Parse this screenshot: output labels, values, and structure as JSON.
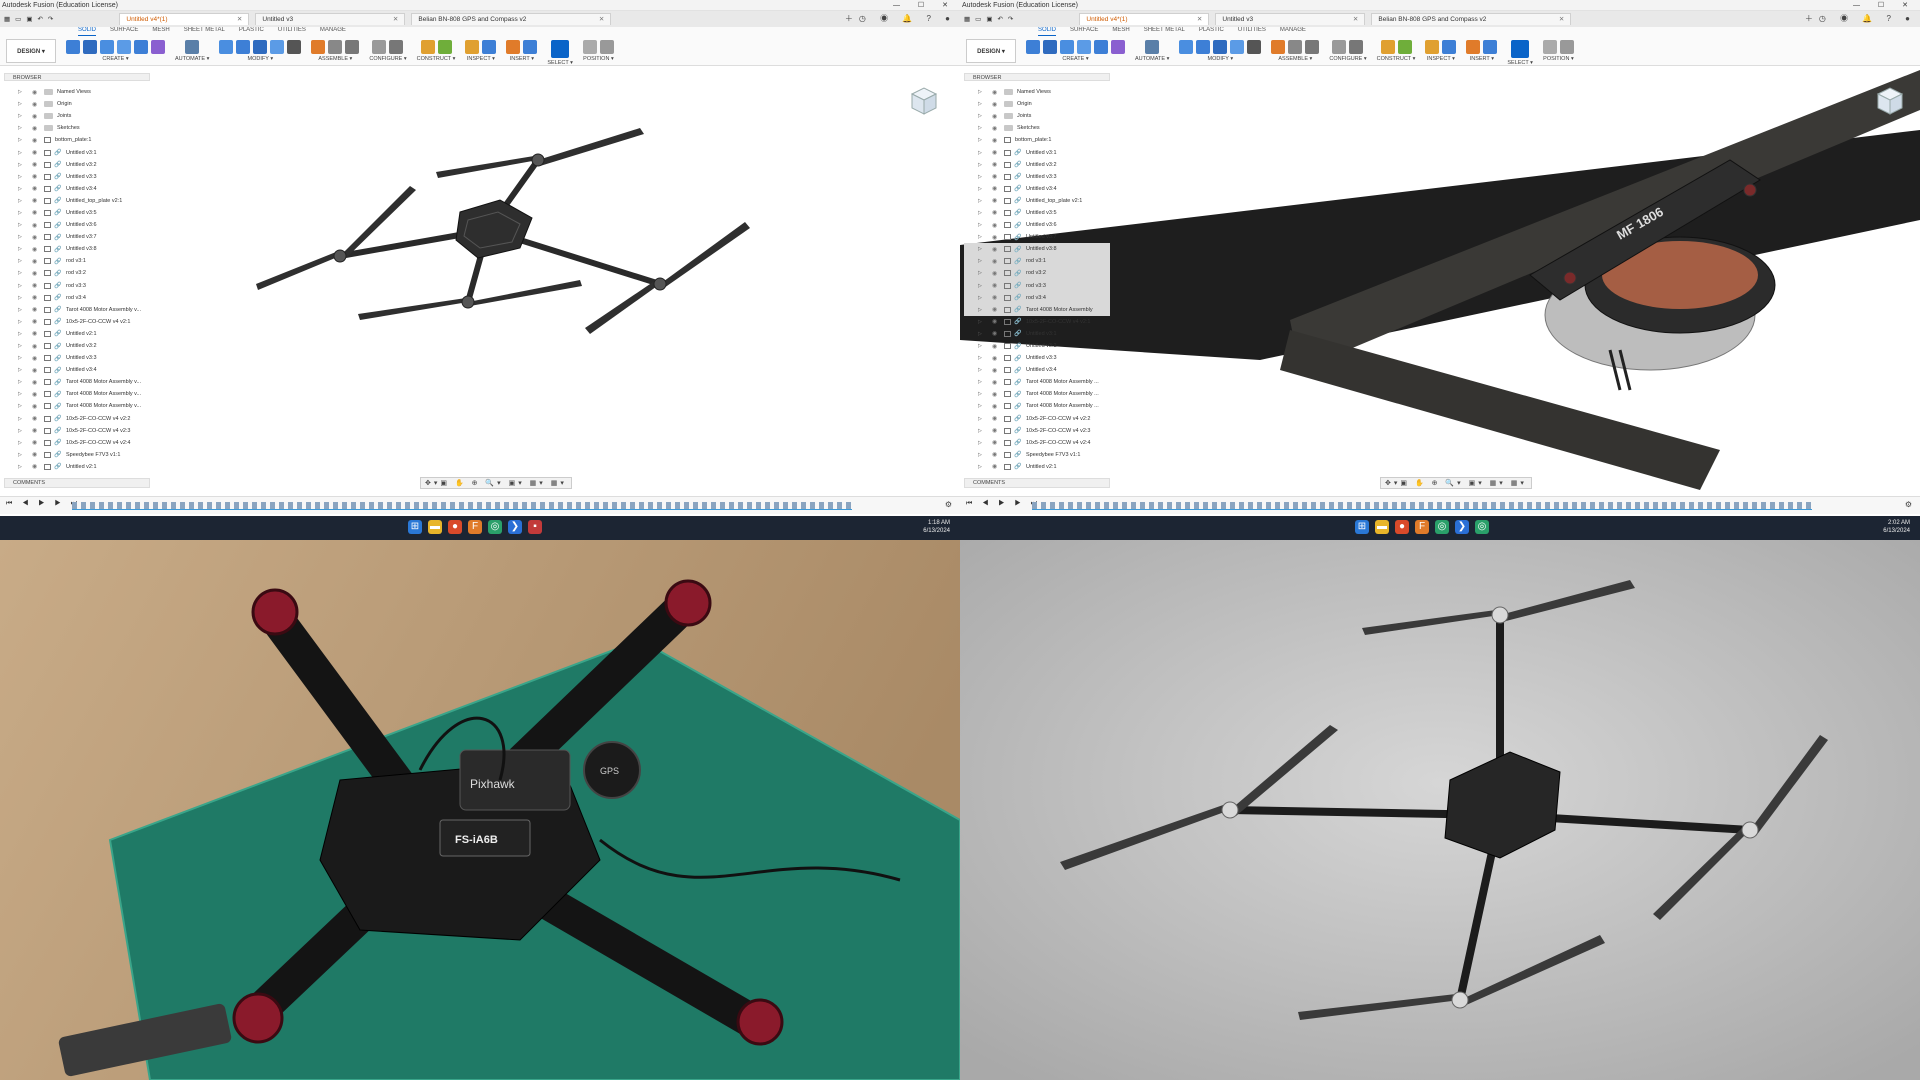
{
  "left": {
    "window_title": "Autodesk Fusion (Education License)",
    "tabs": [
      {
        "label": "Untitled v4*(1)",
        "active": true
      },
      {
        "label": "Untitled v3",
        "active": false
      },
      {
        "label": "Belian BN-808 GPS and Compass v2",
        "active": false
      }
    ],
    "workspace_tabs": [
      "SOLID",
      "SURFACE",
      "MESH",
      "SHEET METAL",
      "PLASTIC",
      "UTILITIES",
      "MANAGE"
    ],
    "design_label": "DESIGN ▾",
    "toolbar_groups": [
      "CREATE ▾",
      "AUTOMATE ▾",
      "MODIFY ▾",
      "ASSEMBLE ▾",
      "CONFIGURE ▾",
      "CONSTRUCT ▾",
      "INSPECT ▾",
      "INSERT ▾",
      "SELECT ▾",
      "POSITION ▾"
    ],
    "browser_title": "BROWSER",
    "comments_title": "COMMENTS",
    "browser_items": [
      "Named Views",
      "Origin",
      "Joints",
      "Sketches",
      "bottom_plate:1",
      "Untitled v3:1",
      "Untitled v3:2",
      "Untitled v3:3",
      "Untitled v3:4",
      "Untitled_top_plate v2:1",
      "Untitled v3:5",
      "Untitled v3:6",
      "Untitled v3:7",
      "Untitled v3:8",
      "rod v3:1",
      "rod v3:2",
      "rod v3:3",
      "rod v3:4",
      "Tarot 4008 Motor Assembly v...",
      "10x5-2F-CO-CCW v4 v2:1",
      "Untitled v2:1",
      "Untitled v3:2",
      "Untitled v3:3",
      "Untitled v3:4",
      "Tarot 4008 Motor Assembly v...",
      "Tarot 4008 Motor Assembly v...",
      "Tarot 4008 Motor Assembly v...",
      "10x5-2F-CO-CCW v4 v2:2",
      "10x5-2F-CO-CCW v4 v2:3",
      "10x5-2F-CO-CCW v4 v2:4",
      "Speedybee F7V3 v1:1",
      "Untitled v2:1"
    ],
    "clock_time": "1:18 AM",
    "clock_date": "6/13/2024"
  },
  "right": {
    "window_title": "Autodesk Fusion (Education License)",
    "tabs": [
      {
        "label": "Untitled v4*(1)",
        "active": true
      },
      {
        "label": "Untitled v3",
        "active": false
      },
      {
        "label": "Belian BN-808 GPS and Compass v2",
        "active": false
      }
    ],
    "workspace_tabs": [
      "SOLID",
      "SURFACE",
      "MESH",
      "SHEET METAL",
      "PLASTIC",
      "UTILITIES",
      "MANAGE"
    ],
    "design_label": "DESIGN ▾",
    "toolbar_groups": [
      "CREATE ▾",
      "AUTOMATE ▾",
      "MODIFY ▾",
      "ASSEMBLE ▾",
      "CONFIGURE ▾",
      "CONSTRUCT ▾",
      "INSPECT ▾",
      "INSERT ▾",
      "SELECT ▾",
      "POSITION ▾"
    ],
    "browser_title": "BROWSER",
    "comments_title": "COMMENTS",
    "browser_items": [
      "Named Views",
      "Origin",
      "Joints",
      "Sketches",
      "bottom_plate:1",
      "Untitled v3:1",
      "Untitled v3:2",
      "Untitled v3:3",
      "Untitled v3:4",
      "Untitled_top_plate v2:1",
      "Untitled v3:5",
      "Untitled v3:6",
      "Untitled v3:7",
      "Untitled v3:8",
      "rod v3:1",
      "rod v3:2",
      "rod v3:3",
      "rod v3:4",
      "Tarot 4008 Motor Assembly",
      "10x5-2F-CO-CCW v4 v2:1",
      "Untitled v3:1",
      "Untitled v3:2",
      "Untitled v3:3",
      "Untitled v3:4",
      "Tarot 4008 Motor Assembly ...",
      "Tarot 4008 Motor Assembly ...",
      "Tarot 4008 Motor Assembly ...",
      "10x5-2F-CO-CCW v4 v2:2",
      "10x5-2F-CO-CCW v4 v2:3",
      "10x5-2F-CO-CCW v4 v2:4",
      "Speedybee F7V3 v1:1",
      "Untitled v2:1"
    ],
    "motor_label": "MF 1806",
    "clock_time": "2:02 AM",
    "clock_date": "6/13/2024"
  },
  "photo": {
    "fc_label": "Pixhawk",
    "rx_label": "FS-iA6B",
    "gps_label": "GPS"
  },
  "colors": {
    "accent": "#0a64c8",
    "fusion_orange": "#d05b00",
    "mat_green": "#1f7a66",
    "motor_red": "#8a1a2b"
  }
}
